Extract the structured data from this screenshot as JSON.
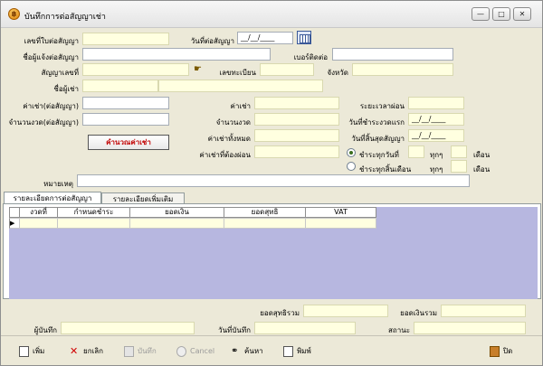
{
  "window": {
    "title": "บันทึกการต่อสัญญาเช่า",
    "minimize_glyph": "—",
    "maximize_glyph": "□",
    "close_glyph": "✕"
  },
  "form": {
    "contract_ext_no_label": "เลขที่ใบต่อสัญญา",
    "contract_ext_no": "",
    "ext_date_label": "วันที่ต่อสัญญา",
    "ext_date": "__/__/____",
    "requester_label": "ชื่อผู้แจ้งต่อสัญญา",
    "requester": "",
    "contact_phone_label": "เบอร์ติดต่อ",
    "contact_phone": "",
    "contract_no_label": "สัญญาเลขที่",
    "contract_no": "",
    "registration_label": "เลขทะเบียน",
    "registration": "",
    "province_label": "จังหวัด",
    "province": "",
    "lessee_label": "ชื่อผู้เช่า",
    "lessee": "",
    "rent_ext_label": "ค่าเช่า(ต่อสัญญา)",
    "rent_ext": "",
    "installments_ext_label": "จำนวนงวด(ต่อสัญญา)",
    "installments_ext": "",
    "calc_button": "คำนวณค่าเช่า",
    "rent_label": "ค่าเช่า",
    "rent": "",
    "installments_label": "จำนวนงวด",
    "installments": "",
    "total_rent_label": "ค่าเช่าทั้งหมด",
    "total_rent": "",
    "rent_due_label": "ค่าเช่าที่ต้องผ่อน",
    "rent_due": "",
    "period_label": "ระยะเวลาผ่อน",
    "period": "",
    "first_pay_label": "วันที่ชำระงวดแรก",
    "first_pay": "__/__/____",
    "end_date_label": "วันที่สิ้นสุดสัญญา",
    "end_date": "__/__/____",
    "pay_day_label": "ชำระทุกวันที่",
    "pay_day_every": "ทุกๆ",
    "pay_day_month": "เดือน",
    "pay_end_label": "ชำระทุกสิ้นเดือน",
    "pay_end_every": "ทุกๆ",
    "pay_end_month": "เดือน",
    "note_label": "หมายเหตุ",
    "note": ""
  },
  "tabs": [
    {
      "label": "รายละเอียดการต่อสัญญา",
      "active": true
    },
    {
      "label": "รายละเอียดเพิ่มเติม",
      "active": false
    }
  ],
  "grid": {
    "columns": [
      "งวดที่",
      "กำหนดชำระ",
      "ยอดเงิน",
      "ยอดสุทธิ",
      "VAT"
    ],
    "row_indicator": "▶"
  },
  "footer": {
    "net_total_label": "ยอดสุทธิรวม",
    "net_total": "",
    "amount_total_label": "ยอดเงินรวม",
    "amount_total": "",
    "recorder_label": "ผู้บันทึก",
    "recorder": "",
    "record_date_label": "วันที่บันทึก",
    "record_date": "",
    "status_label": "สถานะ",
    "status": ""
  },
  "toolbar": {
    "add": "เพิ่ม",
    "cancel_th": "ยกเลิก",
    "save": "บันทึก",
    "cancel_en": "Cancel",
    "search": "ค้นหา",
    "print": "พิมพ์",
    "close": "ปิด"
  }
}
